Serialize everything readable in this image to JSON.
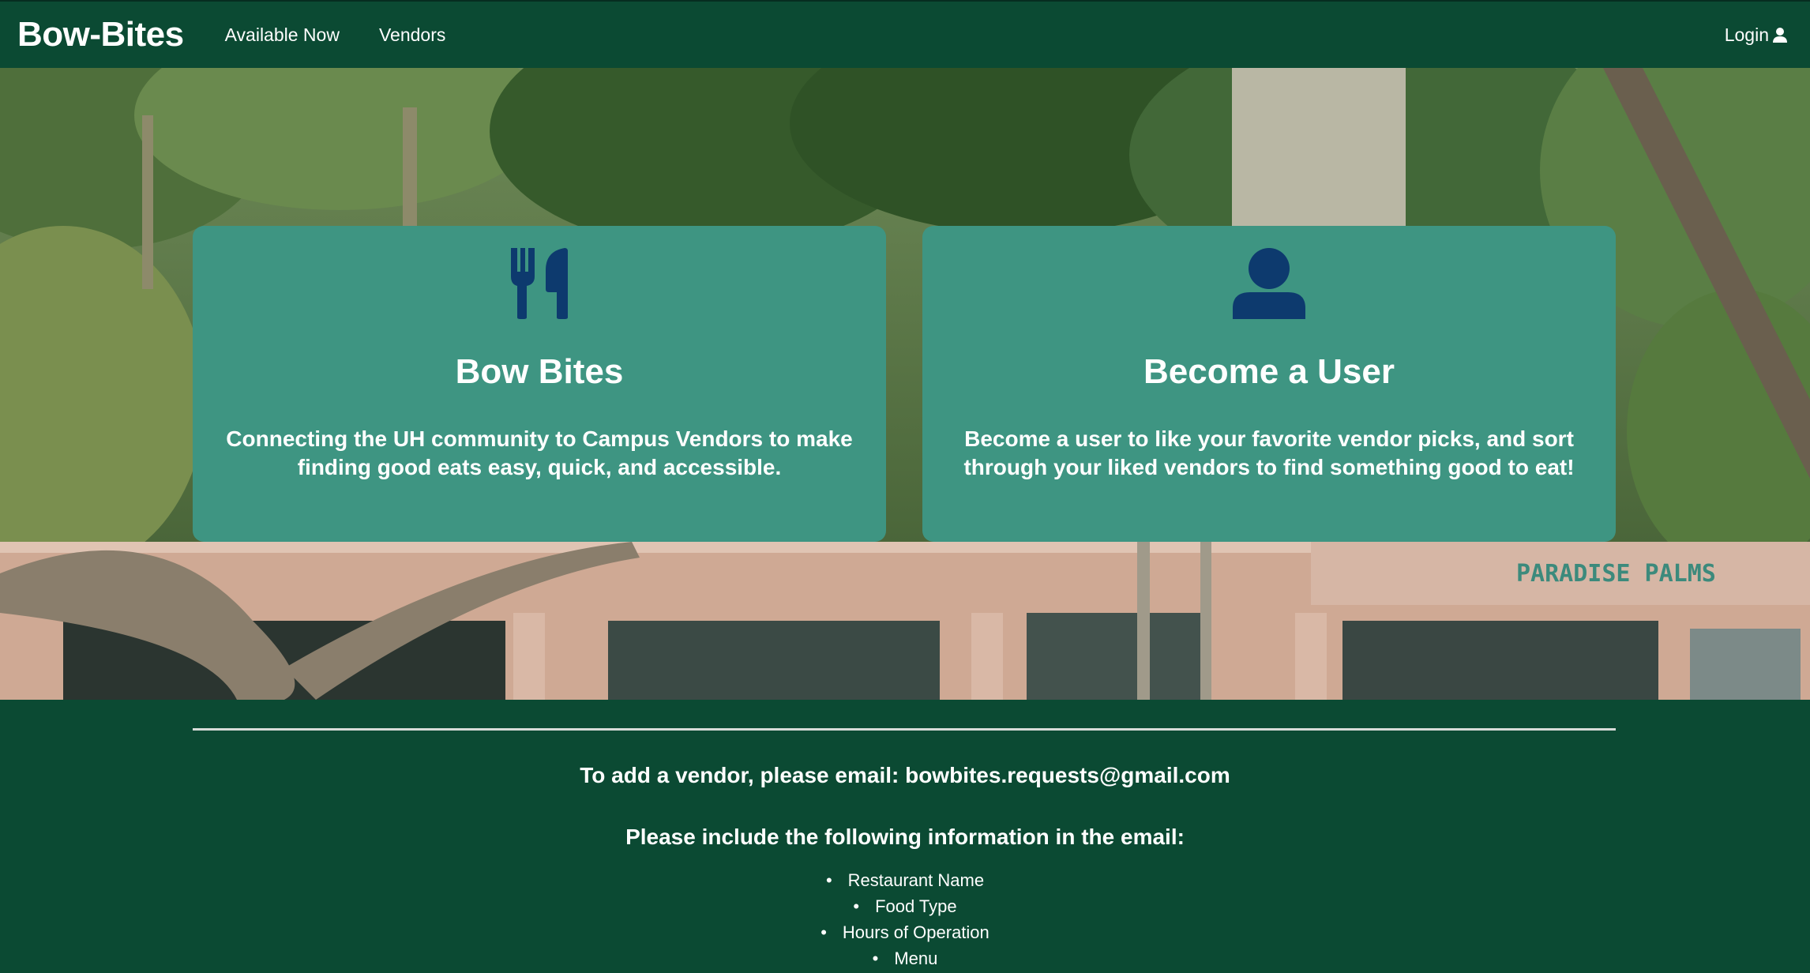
{
  "nav": {
    "brand": "Bow-Bites",
    "links": [
      "Available Now",
      "Vendors"
    ],
    "login_label": "Login"
  },
  "cards": [
    {
      "icon": "utensils-icon",
      "title": "Bow Bites",
      "text": "Connecting the UH community to Campus Vendors to make finding good eats easy, quick, and accessible."
    },
    {
      "icon": "user-icon",
      "title": "Become a User",
      "text": "Become a user to like your favorite vendor picks, and sort through your liked vendors to find something good to eat!"
    }
  ],
  "footer": {
    "line1": "To add a vendor, please email: bowbites.requests@gmail.com",
    "line2": "Please include the following information in the email:",
    "items": [
      "Restaurant Name",
      "Food Type",
      "Hours of Operation",
      "Menu"
    ]
  },
  "colors": {
    "navbar": "#0b4a33",
    "card": "#3e9582",
    "icon": "#0d3a6e"
  }
}
